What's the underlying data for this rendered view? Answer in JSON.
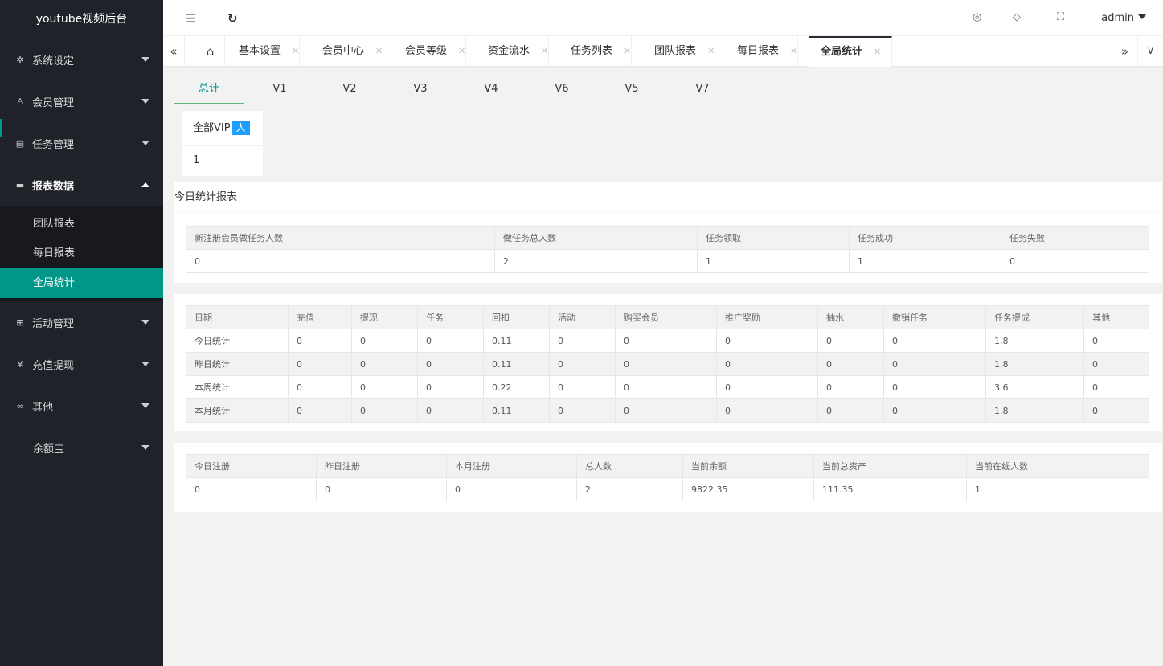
{
  "app": {
    "title": "youtube视频后台"
  },
  "sidebar": {
    "items": [
      {
        "label": "系统设定",
        "icon": "gear-icon"
      },
      {
        "label": "会员管理",
        "icon": "user-icon"
      },
      {
        "label": "任务管理",
        "icon": "document-icon"
      },
      {
        "label": "报表数据",
        "icon": "monitor-icon"
      },
      {
        "label": "活动管理",
        "icon": "gift-icon"
      },
      {
        "label": "充值提现",
        "icon": "yen-icon"
      },
      {
        "label": "其他",
        "icon": "link-icon"
      },
      {
        "label": "余额宝",
        "icon": ""
      }
    ],
    "sub_items": [
      "团队报表",
      "每日报表",
      "全局统计"
    ]
  },
  "header": {
    "user": "admin"
  },
  "tabs": [
    "基本设置",
    "会员中心",
    "会员等级",
    "资金流水",
    "任务列表",
    "团队报表",
    "每日报表",
    "全局统计"
  ],
  "level_tabs": [
    "总计",
    "V1",
    "V2",
    "V3",
    "V4",
    "V6",
    "V5",
    "V7"
  ],
  "vip_card": {
    "title": "全部VIP",
    "badge": "人",
    "value": "1"
  },
  "today_report": {
    "title": "今日统计报表",
    "headers": [
      "新注册会员做任务人数",
      "做任务总人数",
      "任务领取",
      "任务成功",
      "任务失败"
    ],
    "values": [
      "0",
      "2",
      "1",
      "1",
      "0"
    ]
  },
  "stats_table": {
    "headers": [
      "日期",
      "充值",
      "提现",
      "任务",
      "回扣",
      "活动",
      "购买会员",
      "推广奖励",
      "抽水",
      "撤销任务",
      "任务提成",
      "其他"
    ],
    "rows": [
      [
        "今日统计",
        "0",
        "0",
        "0",
        "0.11",
        "0",
        "0",
        "0",
        "0",
        "0",
        "1.8",
        "0"
      ],
      [
        "昨日统计",
        "0",
        "0",
        "0",
        "0.11",
        "0",
        "0",
        "0",
        "0",
        "0",
        "1.8",
        "0"
      ],
      [
        "本周统计",
        "0",
        "0",
        "0",
        "0.22",
        "0",
        "0",
        "0",
        "0",
        "0",
        "3.6",
        "0"
      ],
      [
        "本月统计",
        "0",
        "0",
        "0",
        "0.11",
        "0",
        "0",
        "0",
        "0",
        "0",
        "1.8",
        "0"
      ]
    ]
  },
  "summary_table": {
    "headers": [
      "今日注册",
      "昨日注册",
      "本月注册",
      "总人数",
      "当前余额",
      "当前总资产",
      "当前在线人数"
    ],
    "values": [
      "0",
      "0",
      "0",
      "2",
      "9822.35",
      "111.35",
      "1"
    ]
  }
}
